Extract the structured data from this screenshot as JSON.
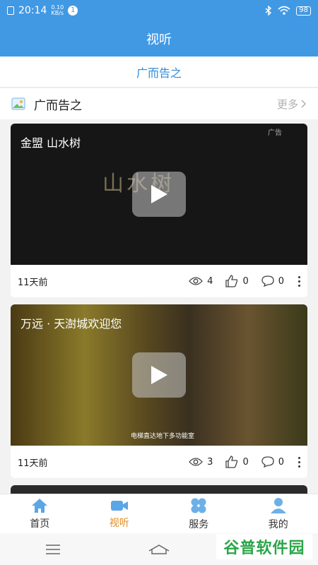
{
  "status_bar": {
    "time": "20:14",
    "net_speed_value": "0.10",
    "net_speed_unit": "KB/s",
    "notification_count": "1",
    "battery": "98"
  },
  "nav": {
    "title": "视听"
  },
  "subtitle": "广而告之",
  "section": {
    "title": "广而告之",
    "more": "更多"
  },
  "cards": [
    {
      "video_title": "金盟  山水树",
      "ad_tag": "广告",
      "brand": "山水树",
      "time_ago": "11天前",
      "views": "4",
      "likes": "0",
      "comments": "0"
    },
    {
      "video_title": "万远 · 天澍城欢迎您",
      "caption": "电梯直达地下多功能室",
      "time_ago": "11天前",
      "views": "3",
      "likes": "0",
      "comments": "0"
    }
  ],
  "tabs": [
    {
      "label": "首页",
      "icon": "home-icon"
    },
    {
      "label": "视听",
      "icon": "video-camera-icon"
    },
    {
      "label": "服务",
      "icon": "services-icon"
    },
    {
      "label": "我的",
      "icon": "user-icon"
    }
  ],
  "colors": {
    "primary": "#4199e4",
    "active_tab": "#e2891b",
    "link": "#2f8bd8"
  },
  "watermark": "谷普软件园"
}
